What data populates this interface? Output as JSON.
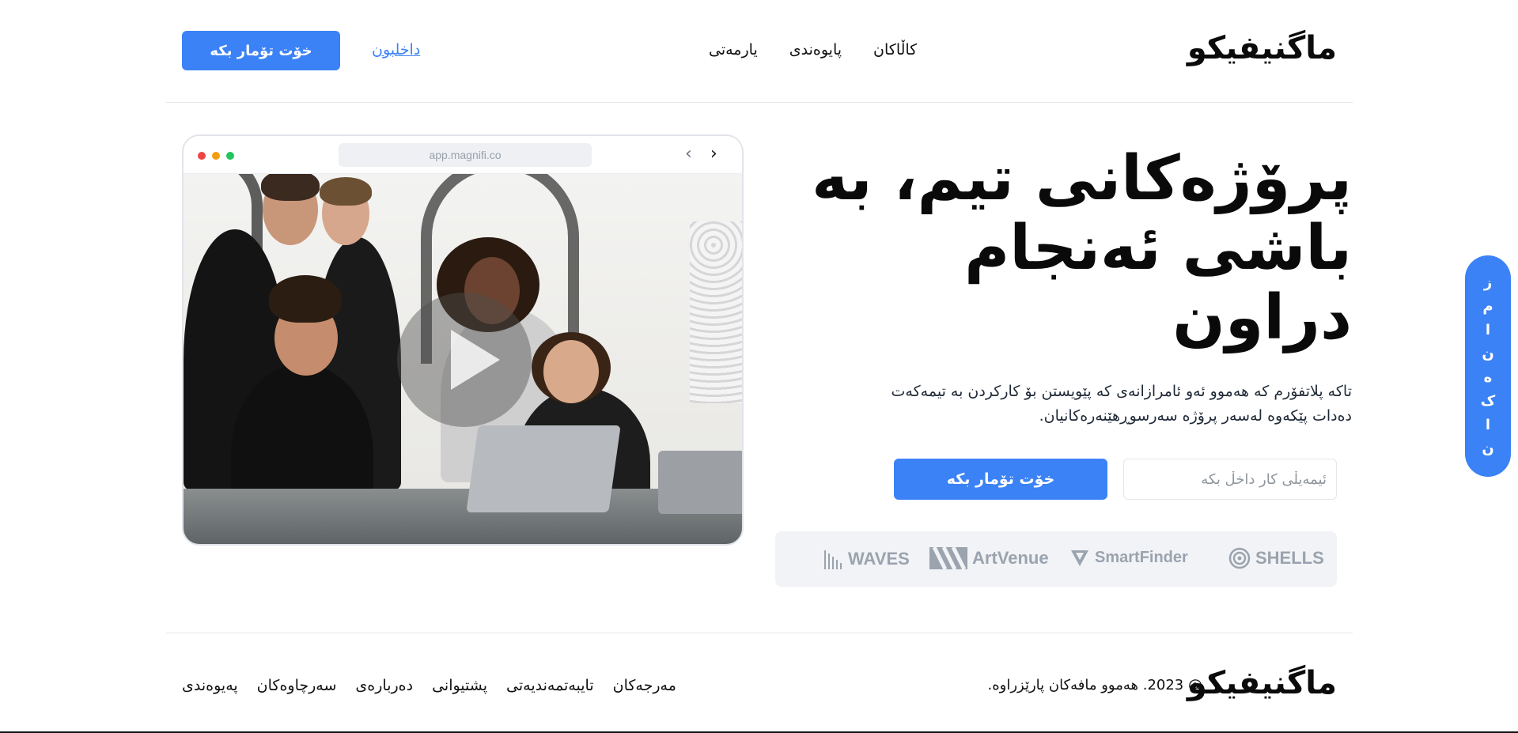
{
  "header": {
    "logo": "ماگنیفیکو",
    "nav_items": [
      "کاڵاکان",
      "پایوەندی",
      "یارمەتی"
    ],
    "login_label": "داخلبون",
    "signup_label": "خۆت تۆمار بکە"
  },
  "browser": {
    "url": "app.magnifi.co",
    "back_icon": "chevron-left-icon",
    "forward_icon": "chevron-right-icon"
  },
  "hero": {
    "title": "پرۆژەکانی تیم، بە باشی ئەنجام دراون",
    "subtitle": "تاکە پلاتفۆرم کە هەموو ئەو ئامرازانەی کە پێویستن بۆ کارکردن بە تیمەکەت دەدات پێکەوە لەسەر پرۆژە سەرسوڕهێنەرەکانیان.",
    "email_placeholder": "ئیمەیڵی کار داخڵ بکە",
    "cta_label": "خۆت تۆمار بکە"
  },
  "brands": [
    "SHELLS",
    "SmartFinder",
    "ArtVenue",
    "WAVES"
  ],
  "side_tab": {
    "letters": [
      "ز",
      "م",
      "ا",
      "ن",
      "ە",
      "ک",
      "ا",
      "ن"
    ]
  },
  "footer": {
    "logo": "ماگنیفیکو",
    "copyright": "@ 2023. هەموو مافەکان پارێزراوە.",
    "links": [
      "مەرجەکان",
      "تایبەتمەندیەتی",
      "پشتیوانی",
      "دەربارەی",
      "سەرچاوەکان",
      "پەیوەندی"
    ]
  },
  "colors": {
    "accent": "#3b82f6",
    "brand_gray": "#9aa3ae",
    "brands_bg": "#f1f3f6"
  }
}
